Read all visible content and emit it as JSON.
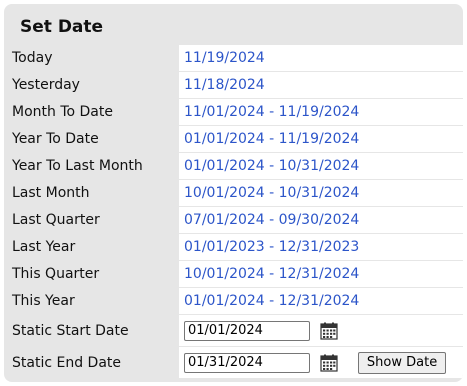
{
  "panel": {
    "title": "Set Date",
    "rows": [
      {
        "label": "Today",
        "value": "11/19/2024"
      },
      {
        "label": "Yesterday",
        "value": "11/18/2024"
      },
      {
        "label": "Month To Date",
        "value": "11/01/2024 - 11/19/2024"
      },
      {
        "label": "Year To Date",
        "value": "01/01/2024 - 11/19/2024"
      },
      {
        "label": "Year To Last Month",
        "value": "01/01/2024 - 10/31/2024"
      },
      {
        "label": "Last Month",
        "value": "10/01/2024 - 10/31/2024"
      },
      {
        "label": "Last Quarter",
        "value": "07/01/2024 - 09/30/2024"
      },
      {
        "label": "Last Year",
        "value": "01/01/2023 - 12/31/2023"
      },
      {
        "label": "This Quarter",
        "value": "10/01/2024 - 12/31/2024"
      },
      {
        "label": "This Year",
        "value": "01/01/2024 - 12/31/2024"
      }
    ],
    "static_start": {
      "label": "Static Start Date",
      "value": "01/01/2024"
    },
    "static_end": {
      "label": "Static End Date",
      "value": "01/31/2024"
    },
    "show_button_label": "Show Date"
  },
  "colors": {
    "link": "#2c55c9",
    "panel_bg": "#e6e6e6",
    "value_bg": "#ffffff"
  },
  "icons": {
    "calendar": "calendar-icon"
  }
}
